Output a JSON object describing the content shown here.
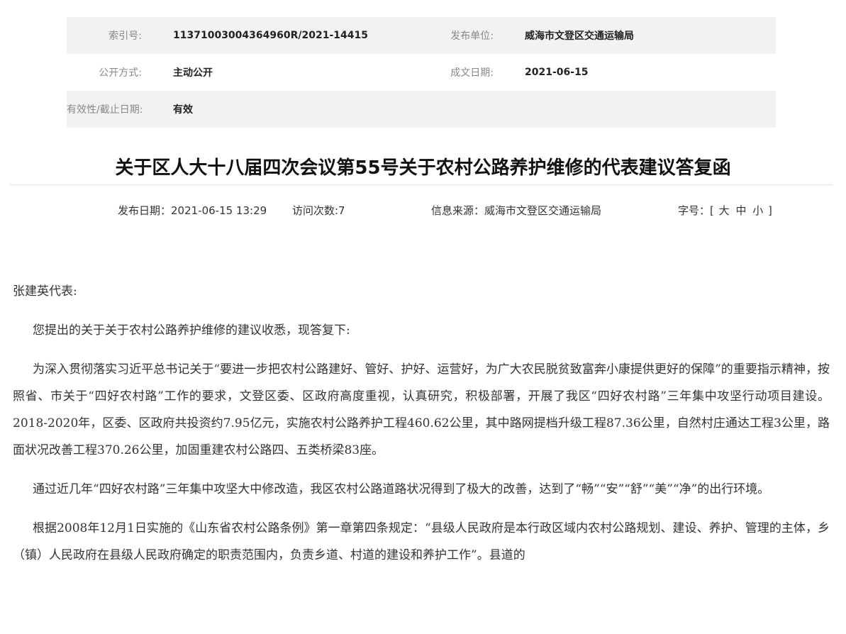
{
  "meta": {
    "index_no_label": "索引号:",
    "index_no": "11371003004364960R/2021-14415",
    "publisher_label": "发布单位:",
    "publisher": "威海市文登区交通运输局",
    "disclosure_label": "公开方式:",
    "disclosure": "主动公开",
    "date_label": "成文日期:",
    "date": "2021-06-15",
    "validity_label": "有效性/截止日期:",
    "validity": "有效"
  },
  "title": "关于区人大十八届四次会议第55号关于农村公路养护维修的代表建议答复函",
  "info": {
    "publish_date": "发布日期：2021-06-15 13:29",
    "visits": "访问次数:7",
    "source": "信息来源：威海市文登区交通运输局",
    "font_size_label": "字号：[",
    "font_large": "大",
    "font_medium": "中",
    "font_small": "小",
    "font_close": "]"
  },
  "article": {
    "salutation": "张建英代表:",
    "paragraphs": [
      "您提出的关于关于农村公路养护维修的建议收悉，现答复下:",
      "为深入贯彻落实习近平总书记关于“要进一步把农村公路建好、管好、护好、运营好，为广大农民脱贫致富奔小康提供更好的保障”的重要指示精神，按照省、市关于“四好农村路”工作的要求，文登区委、区政府高度重视，认真研究，积极部署，开展了我区“四好农村路”三年集中攻坚行动项目建设。2018-2020年，区委、区政府共投资约7.95亿元，实施农村公路养护工程460.62公里，其中路网提档升级工程87.36公里，自然村庄通达工程3公里，路面状况改善工程370.26公里，加固重建农村公路四、五类桥梁83座。",
      "通过近几年“四好农村路”三年集中攻坚大中修改造，我区农村公路道路状况得到了极大的改善，达到了“畅”“安”“舒”“美”“净”的出行环境。",
      "根据2008年12月1日实施的《山东省农村公路条例》第一章第四条规定：“县级人民政府是本行政区域内农村公路规划、建设、养护、管理的主体，乡（镇）人民政府在县级人民政府确定的职责范围内，负责乡道、村道的建设和养护工作”。县道的"
    ]
  }
}
